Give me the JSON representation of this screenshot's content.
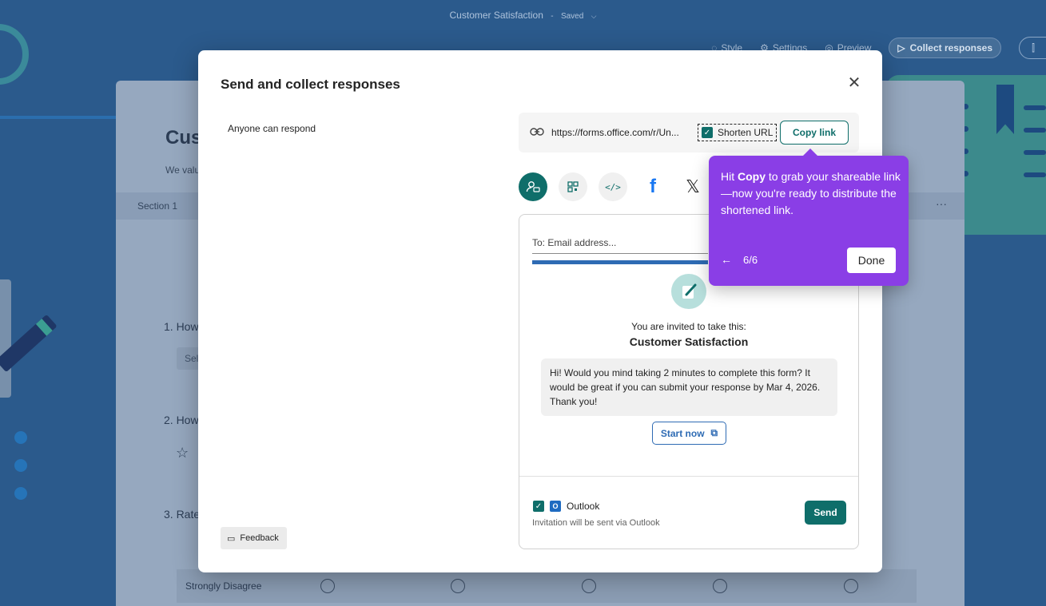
{
  "app": {
    "form_name": "Customer Satisfaction",
    "separator": "-",
    "status": "Saved",
    "toolbar": {
      "style_label": "Style",
      "settings_label": "Settings",
      "preview_label": "Preview",
      "collect_label": "Collect responses"
    }
  },
  "form": {
    "title_fragment": "Cus",
    "desc_fragment": "We valu",
    "section_label": "Section 1",
    "section_more": "···",
    "q1": "1. How",
    "q1_select": "Sel",
    "q2": "2. How",
    "q3": "3. Rate",
    "likert_label": "Strongly Disagree"
  },
  "modal": {
    "title": "Send and collect responses",
    "audience": "Anyone can respond",
    "feedback_label": "Feedback",
    "link": {
      "url": "https://forms.office.com/r/Un...",
      "shorten_label": "Shorten URL",
      "copy_label": "Copy link"
    },
    "email": {
      "to_placeholder": "To: Email address...",
      "invite_line": "You are invited to take this:",
      "invite_title": "Customer Satisfaction",
      "message": "Hi! Would you mind taking 2 minutes to complete this form? It would be great if you can submit your response by Mar 4, 2026. Thank you!",
      "start_label": "Start now",
      "outlook_label": "Outlook",
      "outlook_note": "Invitation will be sent via Outlook",
      "send_label": "Send"
    }
  },
  "coach": {
    "text_pre": "Hit ",
    "text_bold": "Copy",
    "text_post": " to grab your shareable link—now you're ready to distribute the shortened link.",
    "back": "←",
    "step": "6/6",
    "done_label": "Done"
  },
  "colors": {
    "accent": "#0f6e6a",
    "coach": "#8a3ee6",
    "link_blue": "#2e6bb4"
  }
}
